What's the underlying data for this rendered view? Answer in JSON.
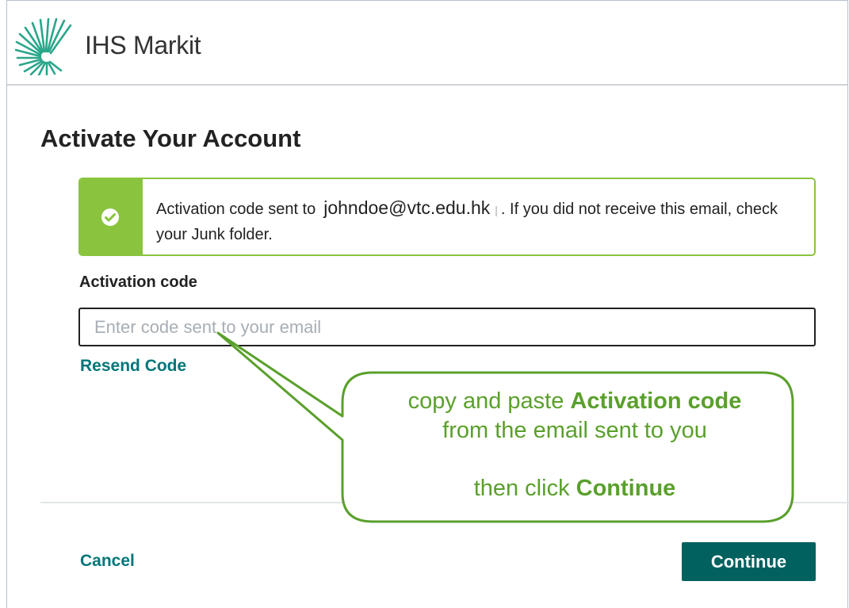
{
  "header": {
    "brand_name": "IHS Markit",
    "logo_icon": "ihs-markit-logo-icon"
  },
  "page": {
    "title": "Activate Your Account"
  },
  "alert": {
    "icon": "check-circle-icon",
    "text_before": "Activation code sent to",
    "email": "johndoe@vtc.edu.hk",
    "separator": "|",
    "text_after": ". If you did not receive this email, check your Junk folder."
  },
  "form": {
    "field_label": "Activation code",
    "input_placeholder": "Enter code sent to your email",
    "input_value": "",
    "resend_label": "Resend Code"
  },
  "footer": {
    "cancel_label": "Cancel",
    "continue_label": "Continue"
  },
  "callout": {
    "line1_prefix": "copy and paste",
    "line1_bold": "Activation code",
    "line2": "from the email sent to you",
    "line3_prefix": "then click",
    "line3_bold": "Continue"
  },
  "colors": {
    "accent_green": "#8ac43f",
    "button_teal": "#00615f",
    "link_teal": "#00767a",
    "callout_green": "#5aa02c"
  }
}
